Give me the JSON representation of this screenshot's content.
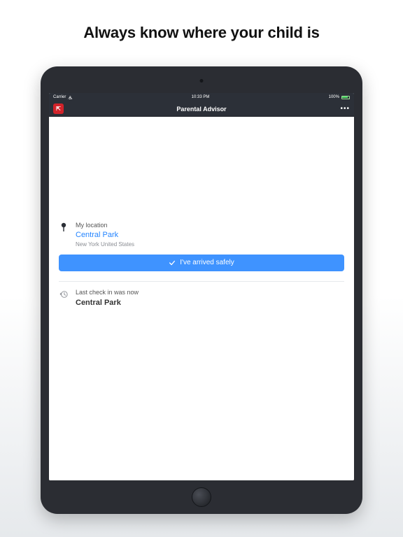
{
  "promo": {
    "title": "Always know where your child is"
  },
  "status": {
    "carrier": "Carrier",
    "time": "10:33 PM",
    "battery_pct": "100%"
  },
  "nav": {
    "title": "Parental Advisor",
    "more_label": "•••"
  },
  "location": {
    "label": "My location",
    "name": "Central Park",
    "region": "New York United States"
  },
  "arrive_button": {
    "label": "I've arrived safely"
  },
  "checkin": {
    "status_line": "Last check in was now",
    "place": "Central Park"
  }
}
